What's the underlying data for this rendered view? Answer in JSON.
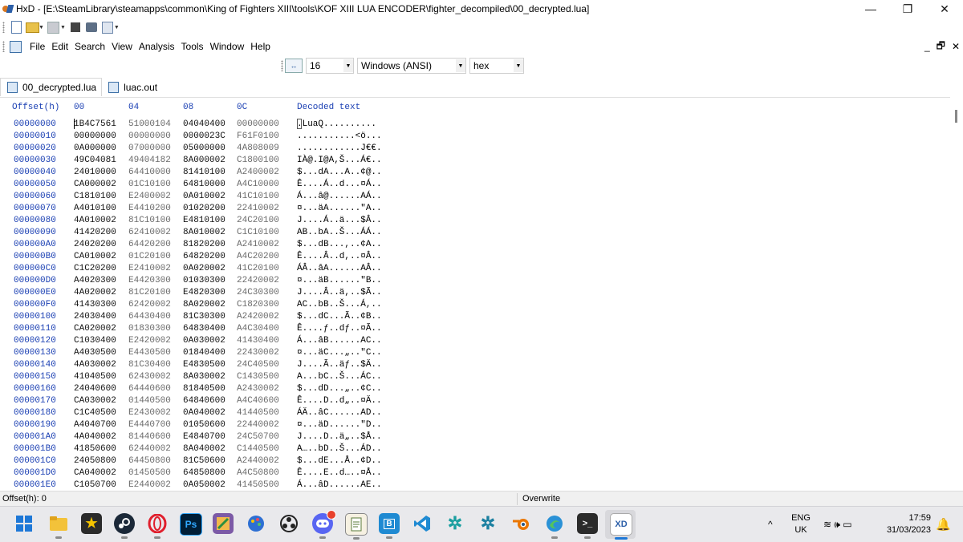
{
  "window": {
    "title": "HxD - [E:\\SteamLibrary\\steamapps\\common\\King of Fighters XIII\\tools\\KOF XIII LUA ENCODER\\fighter_decompiled\\00_decrypted.lua]",
    "minimize_glyph": "—",
    "restore_glyph": "❐",
    "close_glyph": "✕"
  },
  "menu": {
    "items": [
      "File",
      "Edit",
      "Search",
      "View",
      "Analysis",
      "Tools",
      "Window",
      "Help"
    ],
    "mdi_minimize": "_",
    "mdi_restore": "🗗",
    "mdi_close": "✕"
  },
  "toolbar2": {
    "columns_icon_label": "↔",
    "bytes_per_row": "16",
    "charset": "Windows (ANSI)",
    "offset_base": "hex"
  },
  "tabs": [
    {
      "label": "00_decrypted.lua",
      "active": true
    },
    {
      "label": "luac.out",
      "active": false
    }
  ],
  "hex": {
    "header": {
      "offset": "Offset(h)",
      "col0": "00",
      "col1": "04",
      "col2": "08",
      "col3": "0C",
      "decoded": "Decoded text"
    },
    "rows": [
      {
        "offset": "00000000",
        "g": [
          "1B4C7561",
          "51000104",
          "04040400",
          "00000000"
        ],
        "text": ".LuaQ.........."
      },
      {
        "offset": "00000010",
        "g": [
          "00000000",
          "00000000",
          "0000023C",
          "F61F0100"
        ],
        "text": "...........<ö..."
      },
      {
        "offset": "00000020",
        "g": [
          "0A000000",
          "07000000",
          "05000000",
          "4A808009"
        ],
        "text": "............J€€."
      },
      {
        "offset": "00000030",
        "g": [
          "49C04081",
          "49404182",
          "8A000002",
          "C1800100"
        ],
        "text": "IÀ@.I@A,Š...Á€.."
      },
      {
        "offset": "00000040",
        "g": [
          "24010000",
          "64410000",
          "81410100",
          "A2400002"
        ],
        "text": "$...dA...A..¢@.."
      },
      {
        "offset": "00000050",
        "g": [
          "CA000002",
          "01C10100",
          "64810000",
          "A4C10000"
        ],
        "text": "Ê....Á..d...¤Á.."
      },
      {
        "offset": "00000060",
        "g": [
          "C1810100",
          "E2400002",
          "0A010002",
          "41C10100"
        ],
        "text": "Á...â@......AÁ.."
      },
      {
        "offset": "00000070",
        "g": [
          "A4010100",
          "E4410200",
          "01020200",
          "22410002"
        ],
        "text": "¤...äA......\"A.."
      },
      {
        "offset": "00000080",
        "g": [
          "4A010002",
          "81C10100",
          "E4810100",
          "24C20100"
        ],
        "text": "J....Á..ä...$Â.."
      },
      {
        "offset": "00000090",
        "g": [
          "41420200",
          "62410002",
          "8A010002",
          "C1C10100"
        ],
        "text": "AB..bA..Š...ÁÁ.."
      },
      {
        "offset": "000000A0",
        "g": [
          "24020200",
          "64420200",
          "81820200",
          "A2410002"
        ],
        "text": "$...dB...,..¢A.."
      },
      {
        "offset": "000000B0",
        "g": [
          "CA010002",
          "01C20100",
          "64820200",
          "A4C20200"
        ],
        "text": "Ê....Â..d,..¤Â.."
      },
      {
        "offset": "000000C0",
        "g": [
          "C1C20200",
          "E2410002",
          "0A020002",
          "41C20100"
        ],
        "text": "ÁÂ..âA......AÂ.."
      },
      {
        "offset": "000000D0",
        "g": [
          "A4020300",
          "E4420300",
          "01030300",
          "22420002"
        ],
        "text": "¤...äB......\"B.."
      },
      {
        "offset": "000000E0",
        "g": [
          "4A020002",
          "81C20100",
          "E4820300",
          "24C30300"
        ],
        "text": "J....Â..ä,..$Ã.."
      },
      {
        "offset": "000000F0",
        "g": [
          "41430300",
          "62420002",
          "8A020002",
          "C1820300"
        ],
        "text": "AC..bB..Š...Á,.."
      },
      {
        "offset": "00000100",
        "g": [
          "24030400",
          "64430400",
          "81C30300",
          "A2420002"
        ],
        "text": "$...dC...Ã..¢B.."
      },
      {
        "offset": "00000110",
        "g": [
          "CA020002",
          "01830300",
          "64830400",
          "A4C30400"
        ],
        "text": "Ê....ƒ..dƒ..¤Ã.."
      },
      {
        "offset": "00000120",
        "g": [
          "C1030400",
          "E2420002",
          "0A030002",
          "41430400"
        ],
        "text": "Á...âB......AC.."
      },
      {
        "offset": "00000130",
        "g": [
          "A4030500",
          "E4430500",
          "01840400",
          "22430002"
        ],
        "text": "¤...äC...„..\"C.."
      },
      {
        "offset": "00000140",
        "g": [
          "4A030002",
          "81C30400",
          "E4830500",
          "24C40500"
        ],
        "text": "J....Ã..äƒ..$Ä.."
      },
      {
        "offset": "00000150",
        "g": [
          "41040500",
          "62430002",
          "8A030002",
          "C1430500"
        ],
        "text": "A...bC..Š...ÁC.."
      },
      {
        "offset": "00000160",
        "g": [
          "24040600",
          "64440600",
          "81840500",
          "A2430002"
        ],
        "text": "$...dD...„..¢C.."
      },
      {
        "offset": "00000170",
        "g": [
          "CA030002",
          "01440500",
          "64840600",
          "A4C40600"
        ],
        "text": "Ê....D..d„..¤Ä.."
      },
      {
        "offset": "00000180",
        "g": [
          "C1C40500",
          "E2430002",
          "0A040002",
          "41440500"
        ],
        "text": "ÁÄ..âC......AD.."
      },
      {
        "offset": "00000190",
        "g": [
          "A4040700",
          "E4440700",
          "01050600",
          "22440002"
        ],
        "text": "¤...äD......\"D.."
      },
      {
        "offset": "000001A0",
        "g": [
          "4A040002",
          "81440600",
          "E4840700",
          "24C50700"
        ],
        "text": "J....D..ä„..$Å.."
      },
      {
        "offset": "000001B0",
        "g": [
          "41850600",
          "62440002",
          "8A040002",
          "C1440500"
        ],
        "text": "A…..bD..Š...ÁD.."
      },
      {
        "offset": "000001C0",
        "g": [
          "24050800",
          "64450800",
          "81C50600",
          "A2440002"
        ],
        "text": "$...dE...Å..¢D.."
      },
      {
        "offset": "000001D0",
        "g": [
          "CA040002",
          "01450500",
          "64850800",
          "A4C50800"
        ],
        "text": "Ê....E..d…..¤Å.."
      },
      {
        "offset": "000001E0",
        "g": [
          "C1050700",
          "E2440002",
          "0A050002",
          "41450500"
        ],
        "text": "Á...âD......AE.."
      }
    ]
  },
  "status": {
    "offset": "Offset(h): 0",
    "mode": "Overwrite"
  },
  "taskbar": {
    "tray_chevron": "^",
    "lang_line1": "ENG",
    "lang_line2": "UK",
    "tray_icons": "≋ 🕪 ▭",
    "time": "17:59",
    "date": "31/03/2023"
  },
  "colors": {
    "offset_blue": "#1a3fb3",
    "start_blue": "#1e78d7",
    "steam_dark": "#1b2838",
    "opera_red": "#e01f2d",
    "ps_blue": "#001e36",
    "vscode_blue": "#1f8ad2"
  }
}
